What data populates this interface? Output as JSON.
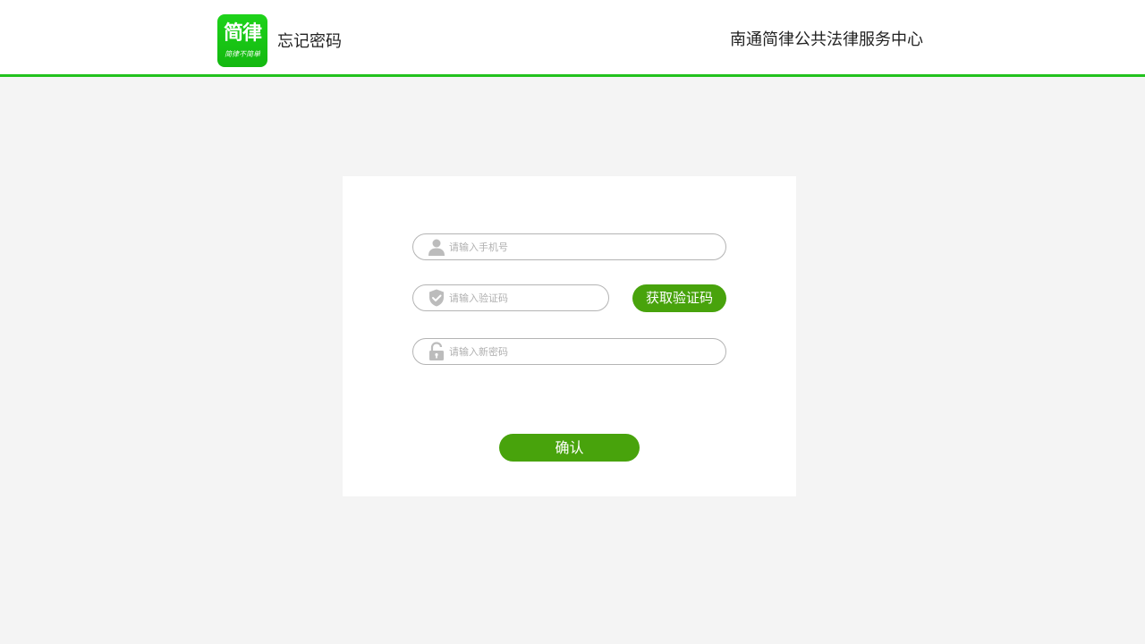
{
  "header": {
    "logo_main": "简律",
    "logo_sub": "简律不简单",
    "page_title": "忘记密码",
    "org_name": "南通简律公共法律服务中心"
  },
  "form": {
    "phone": {
      "placeholder": "请输入手机号",
      "icon": "user-icon"
    },
    "code": {
      "placeholder": "请输入验证码",
      "icon": "shield-check-icon"
    },
    "get_code_label": "获取验证码",
    "new_password": {
      "placeholder": "请输入新密码",
      "icon": "unlock-icon"
    },
    "confirm_label": "确认"
  },
  "colors": {
    "brand_green": "#22c21e",
    "button_green": "#48a30c",
    "background": "#f4f4f4"
  }
}
